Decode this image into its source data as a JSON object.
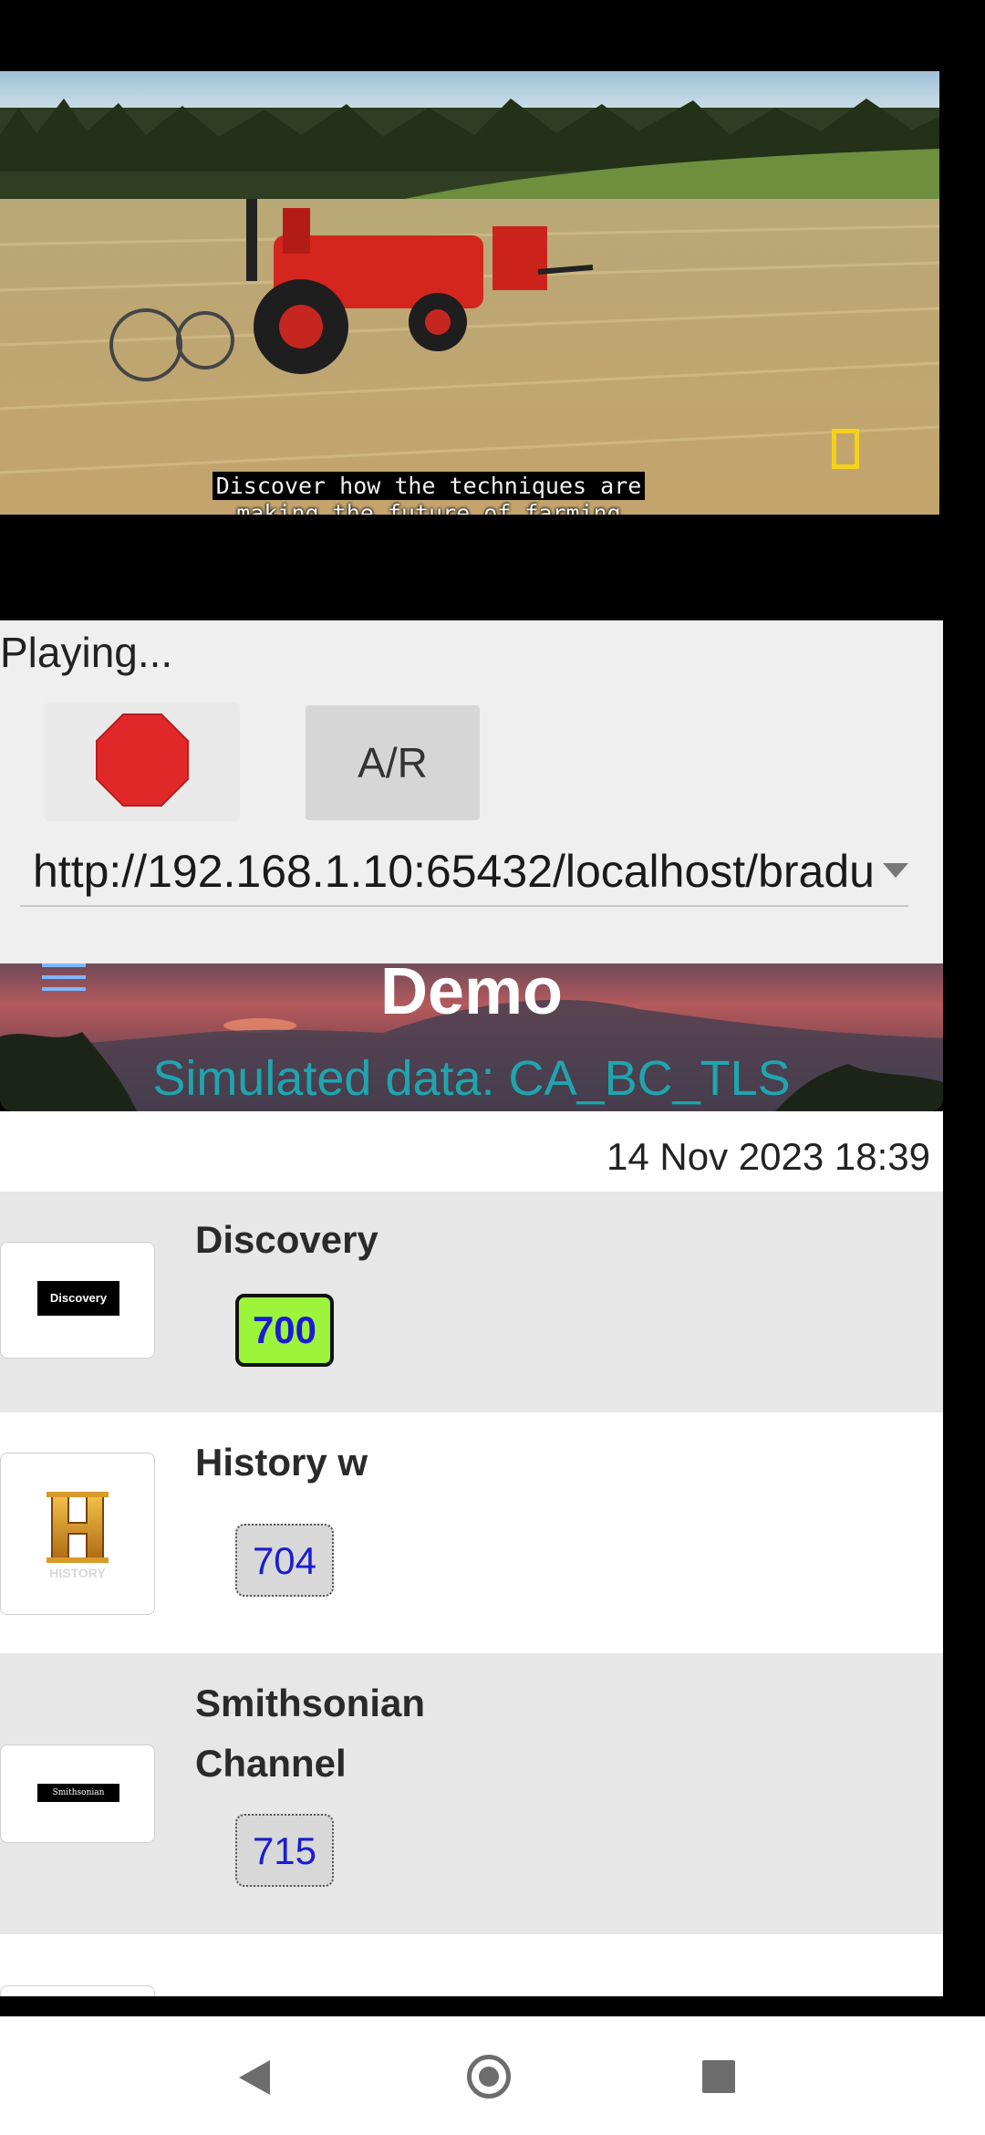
{
  "video": {
    "subtitle_line1": "Discover how the techniques are",
    "subtitle_line2": "making the future of farming"
  },
  "player": {
    "status": "Playing...",
    "ar_button_label": "A/R",
    "stream_url": "http://192.168.1.10:65432/localhost/bradu"
  },
  "banner": {
    "title": "Demo",
    "subtitle": "Simulated data: CA_BC_TLS"
  },
  "listing": {
    "timestamp": "14 Nov 2023 18:39",
    "channels": [
      {
        "name": "Discovery",
        "number": "700",
        "logo_text": "Discovery",
        "active": true
      },
      {
        "name": "History w",
        "number": "704",
        "logo_text": "HISTORY",
        "active": false
      },
      {
        "name_line1": "Smithsonian",
        "name_line2": "Channel",
        "number": "715",
        "logo_text": "Smithsonian CHANNEL",
        "active": false
      }
    ]
  },
  "colors": {
    "active_channel_bg": "#9cf53a",
    "channel_number": "#1b1bd4",
    "banner_subtitle": "#1fa5ae",
    "stop_icon": "#e02828"
  }
}
